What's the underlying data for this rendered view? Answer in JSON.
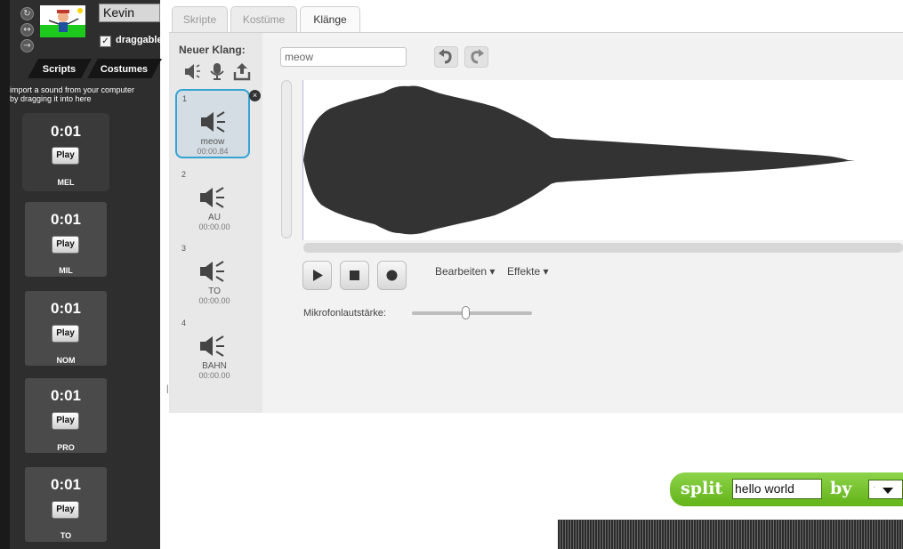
{
  "snap": {
    "sprite_name": "Kevin",
    "draggable_label": "draggable",
    "draggable_checked": "✓",
    "tabs": [
      "Scripts",
      "Costumes"
    ],
    "help_text_line1": "import a sound from your computer",
    "help_text_line2": "by dragging it into here",
    "sounds": [
      {
        "time": "0:01",
        "play": "Play",
        "name": "MEL"
      },
      {
        "time": "0:01",
        "play": "Play",
        "name": "MIL"
      },
      {
        "time": "0:01",
        "play": "Play",
        "name": "NOM"
      },
      {
        "time": "0:01",
        "play": "Play",
        "name": "PRO"
      },
      {
        "time": "0:01",
        "play": "Play",
        "name": "TO"
      }
    ]
  },
  "scratch": {
    "tabs": [
      "Skripte",
      "Kostüme",
      "Klänge"
    ],
    "active_tab": "Klänge",
    "new_sound_label": "Neuer Klang:",
    "sounds": [
      {
        "num": "1",
        "name": "meow",
        "time": "00:00.84"
      },
      {
        "num": "2",
        "name": "AU",
        "time": "00:00.00"
      },
      {
        "num": "3",
        "name": "TO",
        "time": "00:00.00"
      },
      {
        "num": "4",
        "name": "BAHN",
        "time": "00:00.00"
      }
    ],
    "sound_name_value": "meow",
    "edit_menu": "Bearbeiten ▾",
    "effects_menu": "Effekte ▾",
    "mic_volume_label": "Mikrofonlautstärke:",
    "mic_volume_level": 0.45,
    "delete_glyph": "×"
  },
  "split_block": {
    "word_split": "split",
    "input_value": "hello world",
    "word_by": "by",
    "dropdown_value": "·"
  },
  "colors": {
    "selection_border": "#33a3d4",
    "block_green": "#62b318",
    "waveform": "#333333"
  }
}
